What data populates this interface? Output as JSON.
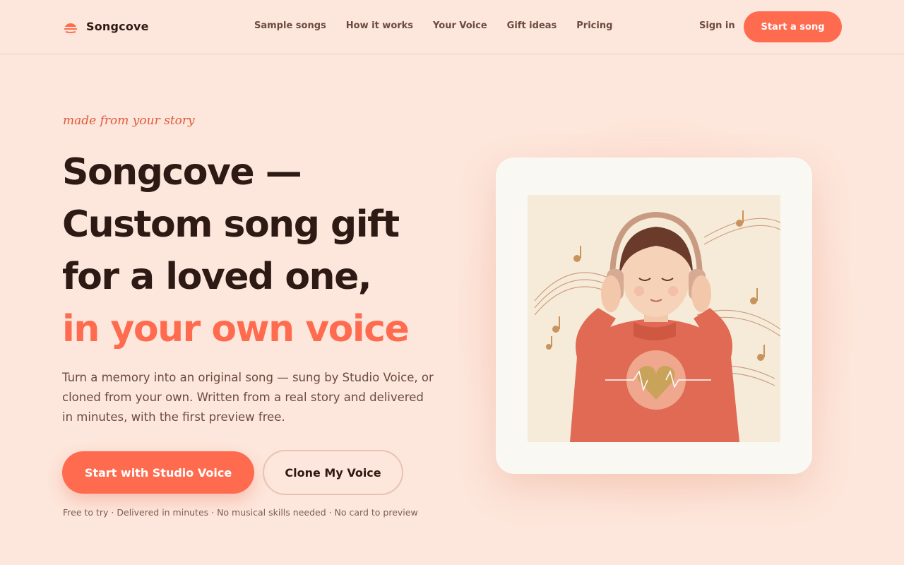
{
  "brand": {
    "name": "Songcove",
    "logo_icon": "half-sun-icon",
    "accent": "#ff6b4f"
  },
  "nav": {
    "items": [
      {
        "label": "Sample songs"
      },
      {
        "label": "How it works"
      },
      {
        "label": "Your Voice"
      },
      {
        "label": "Gift ideas"
      },
      {
        "label": "Pricing"
      }
    ],
    "sign_in": "Sign in",
    "cta": "Start a song"
  },
  "hero": {
    "eyebrow": "made from your story",
    "headline_lines": [
      "Songcove —",
      "Custom song gift",
      "for a loved one,"
    ],
    "headline_accent": "in your own voice",
    "lede": "Turn a memory into an original song — sung by Studio Voice, or cloned from your own. Written from a real story and delivered in minutes, with the first preview free.",
    "primary_button": "Start with Studio Voice",
    "secondary_button": "Clone My Voice",
    "fineprint": "Free to try · Delivered in minutes · No musical skills needed · No card to preview"
  },
  "illustration": {
    "subject": "girl-with-headphones-music-notes-heart-icon"
  },
  "colors": {
    "background": "#fde6db",
    "text_dark": "#2e1a14",
    "text_muted": "#6b4a40",
    "accent": "#ff6b4f"
  }
}
